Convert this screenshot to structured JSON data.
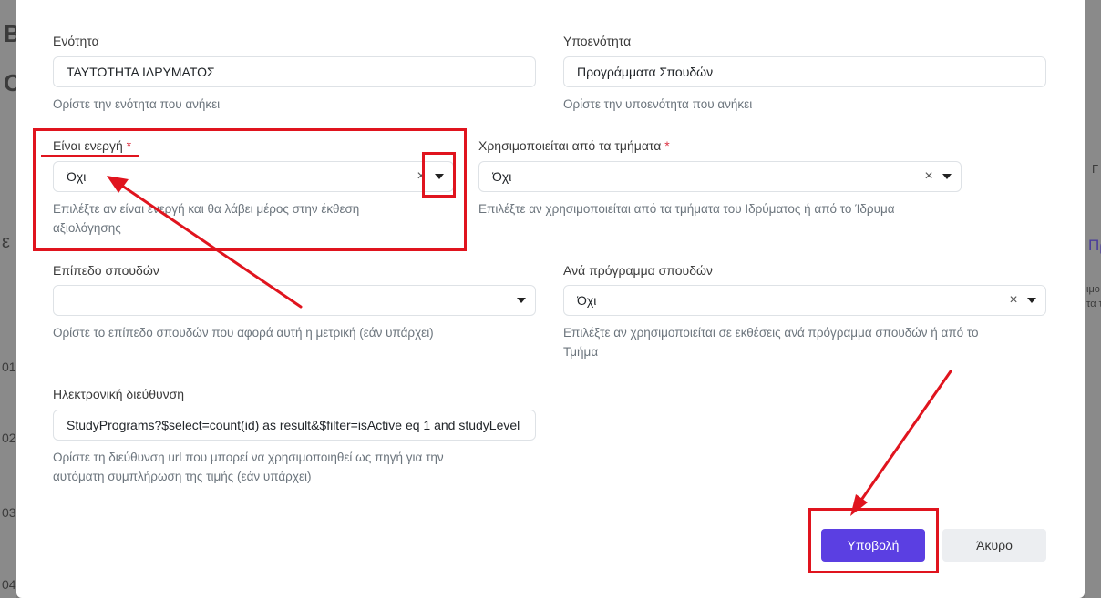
{
  "colors": {
    "primary": "#5b3fe2",
    "annotation": "#e0141e",
    "required": "#dc3545",
    "help": "#6c757d"
  },
  "background_page": {
    "heading_char": "Β",
    "subheading_char": "Ο",
    "fragments": [
      "ε",
      "ιμο",
      "τα τ",
      "Πρ",
      "01",
      "02",
      "03",
      "04",
      "Γ"
    ]
  },
  "form": {
    "section": {
      "label": "Ενότητα",
      "value": "ΤΑΥΤΟΤΗΤΑ ΙΔΡΥΜΑΤΟΣ",
      "help": "Ορίστε την ενότητα που ανήκει"
    },
    "subsection": {
      "label": "Υποενότητα",
      "value": "Προγράμματα Σπουδών",
      "help": "Ορίστε την υποενότητα που ανήκει"
    },
    "is_active": {
      "label": "Είναι ενεργή",
      "required_mark": "*",
      "value": "Όχι",
      "clear_icon": "clear-x-icon",
      "help_line1": "Επιλέξτε αν είναι ενεργή και θα λάβει μέρος στην έκθεση",
      "help_line2": "αξιολόγησης"
    },
    "used_by_departments": {
      "label": "Χρησιμοποιείται από τα τμήματα",
      "required_mark": "*",
      "value": "Όχι",
      "help": "Επιλέξτε αν χρησιμοποιείται από τα τμήματα του Ιδρύματος ή από το Ίδρυμα"
    },
    "study_level": {
      "label": "Επίπεδο σπουδών",
      "value": "",
      "help": "Ορίστε το επίπεδο σπουδών που αφορά αυτή η μετρική (εάν υπάρχει)"
    },
    "per_program": {
      "label": "Ανά πρόγραμμα σπουδών",
      "value": "Όχι",
      "help_line1": "Επιλέξτε αν χρησιμοποιείται σε εκθέσεις ανά πρόγραμμα σπουδών ή από το",
      "help_line2": "Τμήμα"
    },
    "url": {
      "label": "Ηλεκτρονική διεύθυνση",
      "value": "StudyPrograms?$select=count(id) as result&$filter=isActive eq 1 and studyLevel",
      "help_line1": "Ορίστε τη διεύθυνση url που μπορεί να χρησιμοποιηθεί ως πηγή για την",
      "help_line2": "αυτόματη συμπλήρωση της τιμής (εάν υπάρχει)"
    }
  },
  "actions": {
    "submit_label": "Υποβολή",
    "cancel_label": "Άκυρο"
  },
  "icons": {
    "clear": "×",
    "dropdown": "caret-down-icon"
  }
}
